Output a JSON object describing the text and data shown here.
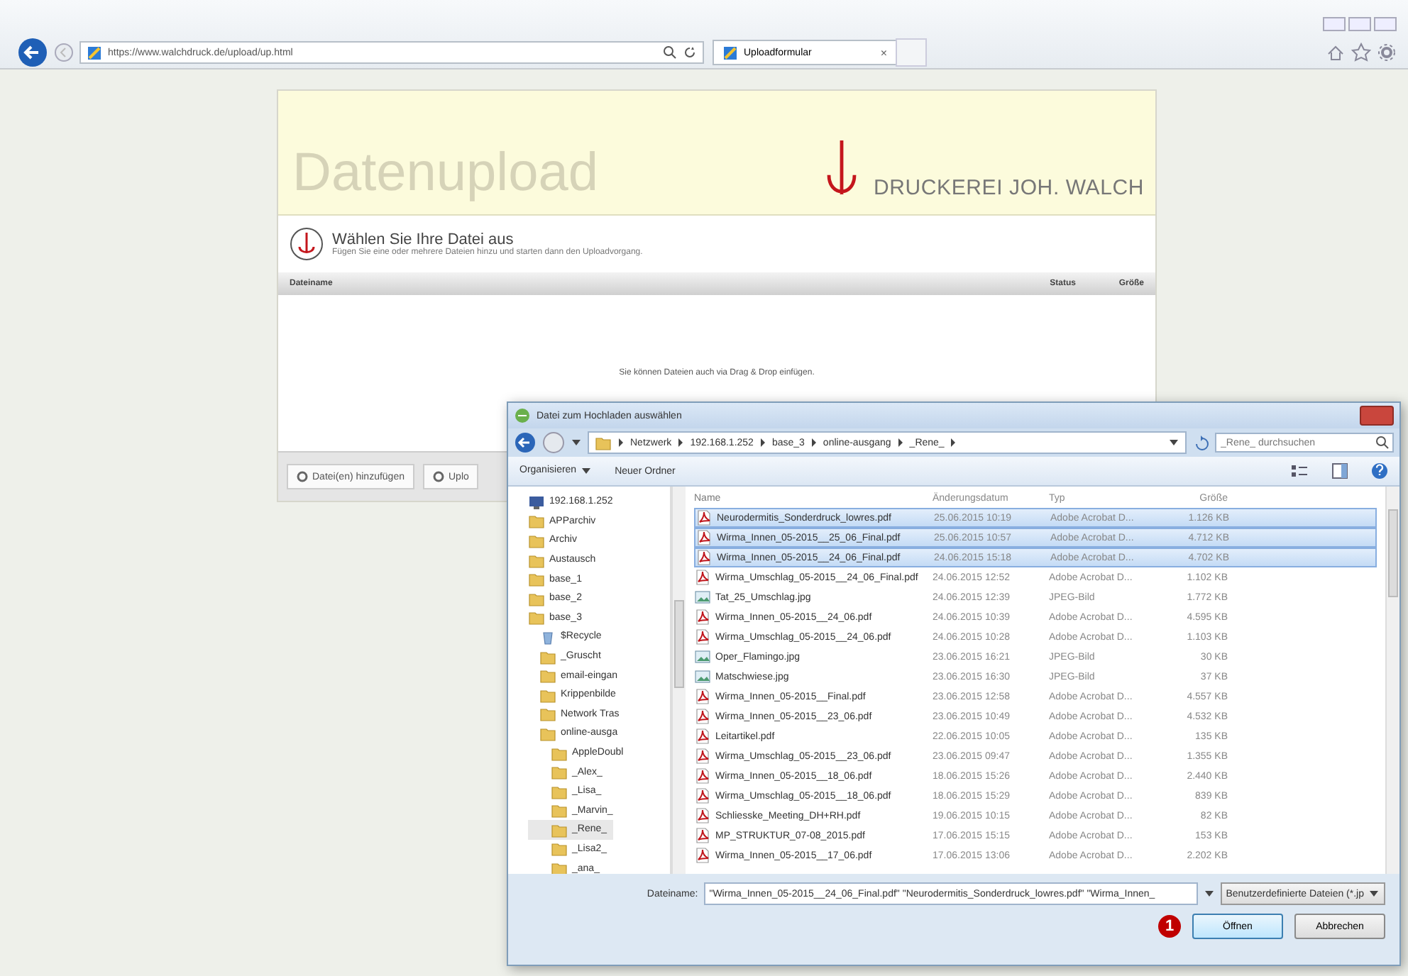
{
  "browser": {
    "url": "https://www.walchdruck.de/upload/up.html",
    "tab": "Uploadformular",
    "tab_close": "×"
  },
  "page": {
    "title": "Datenupload",
    "brand": "DRUCKEREI JOH. WALCH",
    "heading": "Wählen Sie Ihre Datei aus",
    "hint": "Fügen Sie eine oder mehrere Dateien hinzu und starten dann den Uploadvorgang.",
    "columns": [
      "Dateiname",
      "Status",
      "Größe"
    ],
    "empty": "Sie können Dateien auch via Drag & Drop einfügen.",
    "buttons": [
      "Datei(en) hinzufügen",
      "Uplo"
    ]
  },
  "dialog": {
    "title": "Datei zum Hochladen auswählen",
    "path": [
      "Netzwerk",
      "192.168.1.252",
      "base_3",
      "online-ausgang",
      "_Rene_"
    ],
    "search": {
      "placeholder": "_Rene_ durchsuchen"
    },
    "toolbar": [
      "Organisieren",
      "Neuer Ordner"
    ],
    "tree": [
      {
        "label": "192.168.1.252",
        "kind": "computer",
        "selected": false,
        "children": [
          {
            "label": "APParchiv",
            "kind": "folder",
            "selected": false
          },
          {
            "label": "Archiv",
            "kind": "folder",
            "selected": false
          },
          {
            "label": "Austausch",
            "kind": "folder",
            "selected": false
          },
          {
            "label": "base_1",
            "kind": "folder",
            "selected": false
          },
          {
            "label": "base_2",
            "kind": "folder",
            "selected": false
          },
          {
            "label": "base_3",
            "kind": "folder",
            "selected": false,
            "children": [
              {
                "label": "$Recycle",
                "kind": "bin",
                "selected": false
              },
              {
                "label": "_Gruscht",
                "kind": "folder",
                "selected": false
              },
              {
                "label": "email-eingan",
                "kind": "folder",
                "selected": false
              },
              {
                "label": "Krippenbilde",
                "kind": "folder",
                "selected": false
              },
              {
                "label": "Network Tras",
                "kind": "folder",
                "selected": false
              },
              {
                "label": "online-ausga",
                "kind": "folder",
                "selected": false,
                "children": [
                  {
                    "label": "AppleDoubl",
                    "kind": "folder",
                    "selected": false
                  },
                  {
                    "label": "_Alex_",
                    "kind": "folder",
                    "selected": false
                  },
                  {
                    "label": "_Lisa_",
                    "kind": "folder",
                    "selected": false
                  },
                  {
                    "label": "_Marvin_",
                    "kind": "folder",
                    "selected": false
                  },
                  {
                    "label": "_Rene_",
                    "kind": "folder",
                    "selected": true
                  },
                  {
                    "label": "_Lisa2_",
                    "kind": "folder",
                    "selected": false
                  },
                  {
                    "label": "_ana_",
                    "kind": "folder",
                    "selected": false
                  }
                ]
              }
            ]
          }
        ]
      }
    ],
    "columns": [
      "Name",
      "Änderungsdatum",
      "Typ",
      "Größe"
    ],
    "files": [
      {
        "name": "Neurodermitis_Sonderdruck_lowres.pdf",
        "date": "25.06.2015 10:19",
        "type": "Adobe Acrobat D...",
        "size": "1.126 KB",
        "kind": "pdf",
        "selected": true
      },
      {
        "name": "Wirma_Innen_05-2015__25_06_Final.pdf",
        "date": "25.06.2015 10:57",
        "type": "Adobe Acrobat D...",
        "size": "4.712 KB",
        "kind": "pdf",
        "selected": true
      },
      {
        "name": "Wirma_Innen_05-2015__24_06_Final.pdf",
        "date": "24.06.2015 15:18",
        "type": "Adobe Acrobat D...",
        "size": "4.702 KB",
        "kind": "pdf",
        "selected": true
      },
      {
        "name": "Wirma_Umschlag_05-2015__24_06_Final.pdf",
        "date": "24.06.2015 12:52",
        "type": "Adobe Acrobat D...",
        "size": "1.102 KB",
        "kind": "pdf",
        "selected": false
      },
      {
        "name": "Tat_25_Umschlag.jpg",
        "date": "24.06.2015 12:39",
        "type": "JPEG-Bild",
        "size": "1.772 KB",
        "kind": "jpg",
        "selected": false
      },
      {
        "name": "Wirma_Innen_05-2015__24_06.pdf",
        "date": "24.06.2015 10:39",
        "type": "Adobe Acrobat D...",
        "size": "4.595 KB",
        "kind": "pdf",
        "selected": false
      },
      {
        "name": "Wirma_Umschlag_05-2015__24_06.pdf",
        "date": "24.06.2015 10:28",
        "type": "Adobe Acrobat D...",
        "size": "1.103 KB",
        "kind": "pdf",
        "selected": false
      },
      {
        "name": "Oper_Flamingo.jpg",
        "date": "23.06.2015 16:21",
        "type": "JPEG-Bild",
        "size": "30 KB",
        "kind": "jpg",
        "selected": false
      },
      {
        "name": "Matschwiese.jpg",
        "date": "23.06.2015 16:30",
        "type": "JPEG-Bild",
        "size": "37 KB",
        "kind": "jpg",
        "selected": false
      },
      {
        "name": "Wirma_Innen_05-2015__Final.pdf",
        "date": "23.06.2015 12:58",
        "type": "Adobe Acrobat D...",
        "size": "4.557 KB",
        "kind": "pdf",
        "selected": false
      },
      {
        "name": "Wirma_Innen_05-2015__23_06.pdf",
        "date": "23.06.2015 10:49",
        "type": "Adobe Acrobat D...",
        "size": "4.532 KB",
        "kind": "pdf",
        "selected": false
      },
      {
        "name": "Leitartikel.pdf",
        "date": "22.06.2015 10:05",
        "type": "Adobe Acrobat D...",
        "size": "135 KB",
        "kind": "pdf",
        "selected": false
      },
      {
        "name": "Wirma_Umschlag_05-2015__23_06.pdf",
        "date": "23.06.2015 09:47",
        "type": "Adobe Acrobat D...",
        "size": "1.355 KB",
        "kind": "pdf",
        "selected": false
      },
      {
        "name": "Wirma_Innen_05-2015__18_06.pdf",
        "date": "18.06.2015 15:26",
        "type": "Adobe Acrobat D...",
        "size": "2.440 KB",
        "kind": "pdf",
        "selected": false
      },
      {
        "name": "Wirma_Umschlag_05-2015__18_06.pdf",
        "date": "18.06.2015 15:29",
        "type": "Adobe Acrobat D...",
        "size": "839 KB",
        "kind": "pdf",
        "selected": false
      },
      {
        "name": "Schliesske_Meeting_DH+RH.pdf",
        "date": "19.06.2015 10:15",
        "type": "Adobe Acrobat D...",
        "size": "82 KB",
        "kind": "pdf",
        "selected": false
      },
      {
        "name": "MP_STRUKTUR_07-08_2015.pdf",
        "date": "17.06.2015 15:15",
        "type": "Adobe Acrobat D...",
        "size": "153 KB",
        "kind": "pdf",
        "selected": false
      },
      {
        "name": "Wirma_Innen_05-2015__17_06.pdf",
        "date": "17.06.2015 13:06",
        "type": "Adobe Acrobat D...",
        "size": "2.202 KB",
        "kind": "pdf",
        "selected": false
      }
    ],
    "filename_label": "Dateiname:",
    "filename": "\"Wirma_Innen_05-2015__24_06_Final.pdf\" \"Neurodermitis_Sonderdruck_lowres.pdf\" \"Wirma_Innen_",
    "filter": "Benutzerdefinierte Dateien (*.jp",
    "buttons": [
      "Öffnen",
      "Abbrechen"
    ],
    "marker": "1"
  }
}
